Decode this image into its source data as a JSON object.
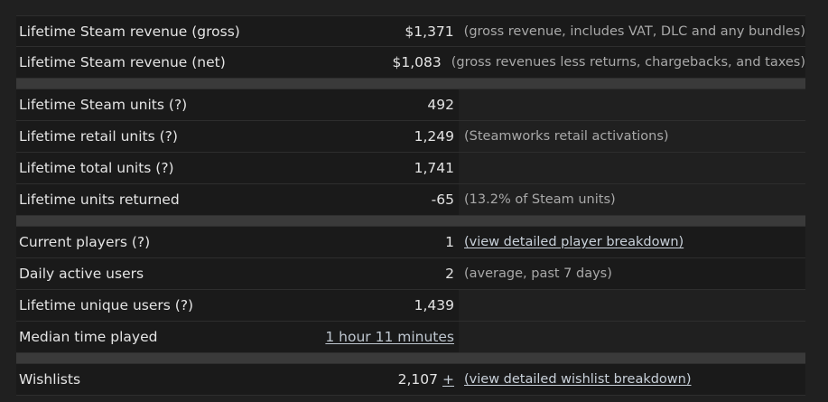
{
  "rows": {
    "gross": {
      "label": "Lifetime Steam revenue (gross)",
      "value": "$1,371",
      "note": "(gross revenue, includes VAT, DLC and any bundles)"
    },
    "net": {
      "label": "Lifetime Steam revenue (net)",
      "value": "$1,083",
      "note": "(gross revenues less returns, chargebacks, and taxes)"
    },
    "steam_units": {
      "label": "Lifetime Steam units (?)",
      "value": "492"
    },
    "retail_units": {
      "label": "Lifetime retail units (?)",
      "value": "1,249",
      "note": "(Steamworks retail activations)"
    },
    "total_units": {
      "label": "Lifetime total units (?)",
      "value": "1,741"
    },
    "returned": {
      "label": "Lifetime units returned",
      "value": "-65",
      "note": "(13.2% of Steam units)"
    },
    "current_players": {
      "label": "Current players (?)",
      "value": "1",
      "link": "(view detailed player breakdown)"
    },
    "dau": {
      "label": "Daily active users",
      "value": "2",
      "note": "(average, past 7 days)"
    },
    "unique_users": {
      "label": "Lifetime unique users (?)",
      "value": "1,439"
    },
    "median_time": {
      "label": "Median time played",
      "value_link": "1 hour 11 minutes"
    },
    "wishlists": {
      "label": "Wishlists",
      "value": "2,107",
      "plus": "+",
      "link": "(view detailed wishlist breakdown)"
    }
  }
}
